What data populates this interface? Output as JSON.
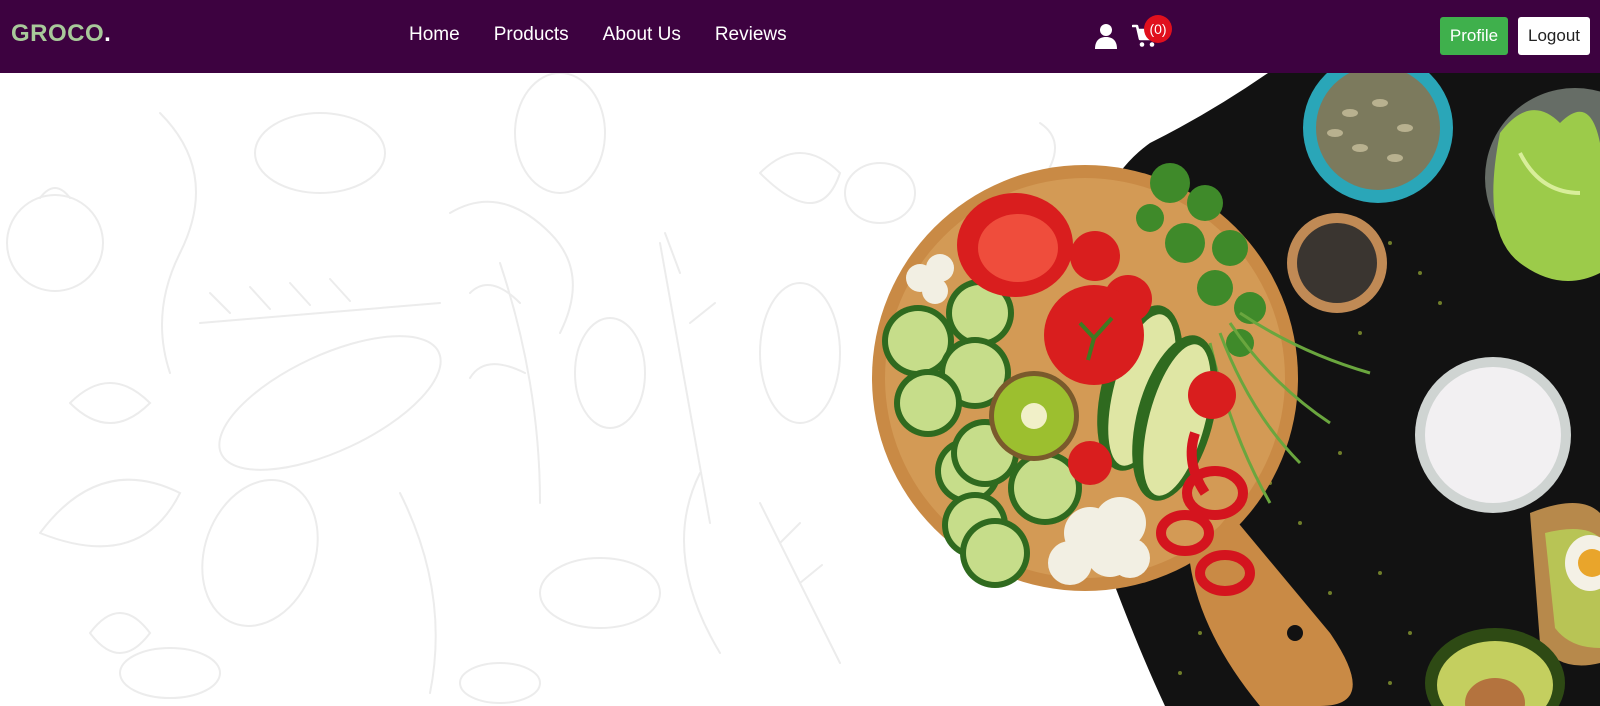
{
  "brand": {
    "name": "GROCO",
    "dot": "."
  },
  "nav": {
    "links": [
      "Home",
      "Products",
      "About Us",
      "Reviews"
    ]
  },
  "cart": {
    "count_label": "(0)"
  },
  "actions": {
    "profile": "Profile",
    "logout": "Logout"
  },
  "colors": {
    "navbar": "#3d0240",
    "brand": "#a8c99a",
    "profile_button": "#3fb04c",
    "badge": "#e0101d",
    "hero_dark": "#121212"
  },
  "icons": [
    "user-icon",
    "cart-icon"
  ]
}
